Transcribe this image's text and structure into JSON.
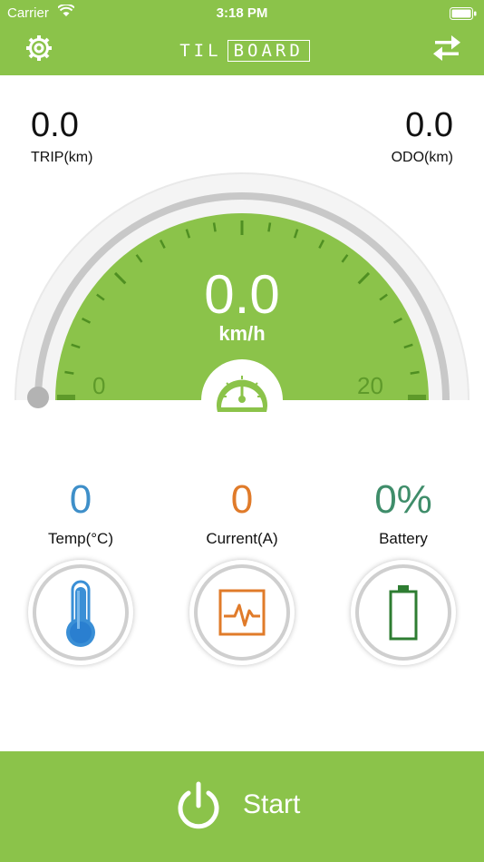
{
  "status_bar": {
    "carrier": "Carrier",
    "time": "3:18 PM"
  },
  "header": {
    "logo_text_a": "TIL",
    "logo_text_b": "BOARD"
  },
  "trip": {
    "value": "0.0",
    "label": "TRIP(km)"
  },
  "odo": {
    "value": "0.0",
    "label": "ODO(km)"
  },
  "speedometer": {
    "value": "0.0",
    "unit": "km/h",
    "scale_min": "0",
    "scale_max": "20",
    "level_fraction": 0
  },
  "metrics": [
    {
      "value": "0",
      "label": "Temp(°C)",
      "color": "#3e8fc9",
      "icon": "thermometer-icon"
    },
    {
      "value": "0",
      "label": "Current(A)",
      "color": "#e07b2a",
      "icon": "current-icon"
    },
    {
      "value": "0%",
      "label": "Battery",
      "color": "#3f8d6a",
      "icon": "battery-icon"
    }
  ],
  "start": {
    "label": "Start"
  },
  "colors": {
    "accent": "#8bc34a",
    "dark_green": "#5e9a2a"
  }
}
